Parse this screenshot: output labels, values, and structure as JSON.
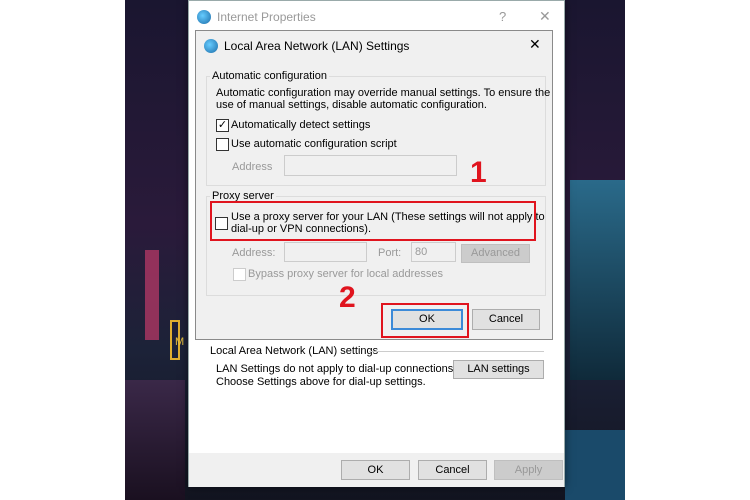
{
  "outer": {
    "title": "Internet Properties",
    "help": "?",
    "close": "✕",
    "lan_group": "Local Area Network (LAN) settings",
    "lan_text1": "LAN Settings do not apply to dial-up connections.",
    "lan_text2": "Choose Settings above for dial-up settings.",
    "lan_button": "LAN settings",
    "ok": "OK",
    "cancel": "Cancel",
    "apply": "Apply"
  },
  "inner": {
    "title": "Local Area Network (LAN) Settings",
    "close": "✕",
    "auto_group": "Automatic configuration",
    "auto_text1": "Automatic configuration may override manual settings.  To ensure the",
    "auto_text2": "use of manual settings, disable automatic configuration.",
    "auto_detect": "Automatically detect settings",
    "auto_detect_checked": true,
    "auto_script": "Use automatic configuration script",
    "auto_script_checked": false,
    "address_label": "Address",
    "address_value": "",
    "proxy_group": "Proxy server",
    "proxy_text1": "Use a proxy server for your LAN (These settings will not apply to",
    "proxy_text2": "dial-up or VPN connections).",
    "proxy_checked": false,
    "proxy_address_label": "Address:",
    "port_label": "Port:",
    "port_value": "80",
    "advanced": "Advanced",
    "bypass": "Bypass proxy server for local addresses",
    "bypass_checked": false,
    "ok": "OK",
    "cancel": "Cancel"
  },
  "annotations": {
    "step1": "1",
    "step2": "2",
    "color": "#e0141e"
  }
}
